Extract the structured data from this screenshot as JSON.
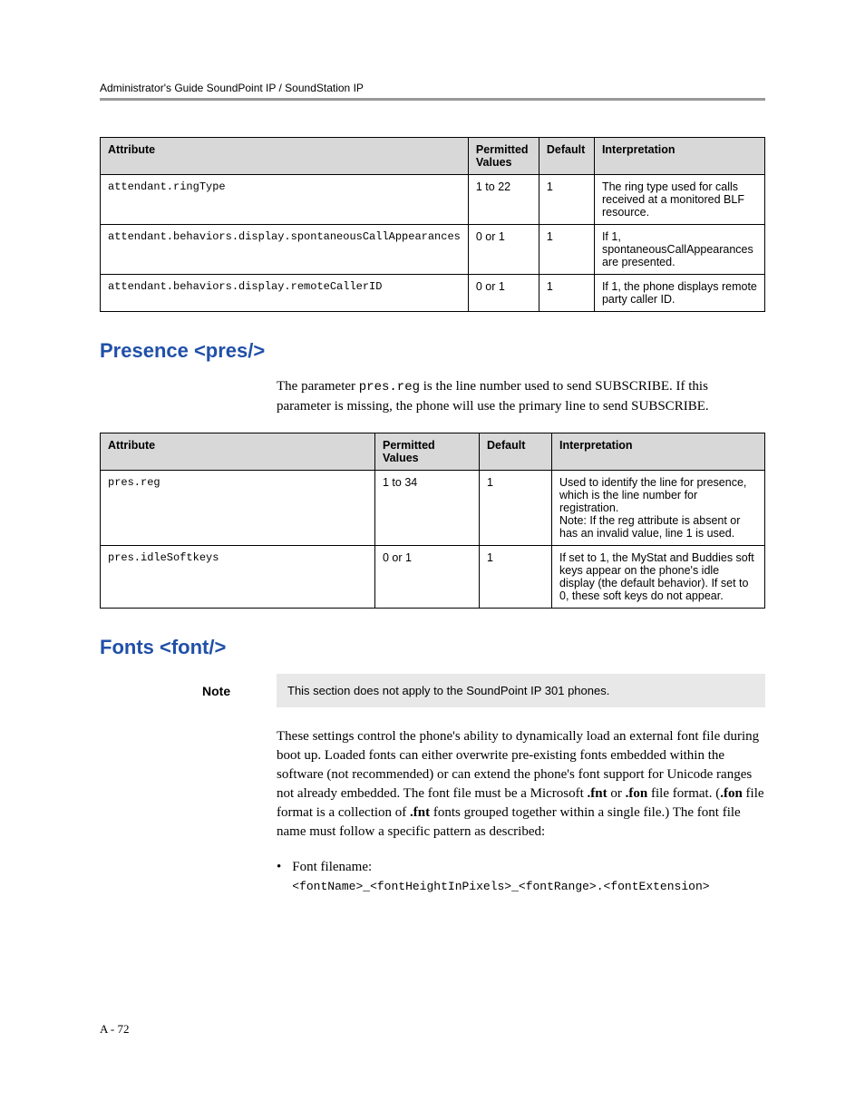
{
  "header": {
    "running_title": "Administrator's Guide SoundPoint IP / SoundStation IP"
  },
  "table1": {
    "head": {
      "c1": "Attribute",
      "c2": "Permitted Values",
      "c3": "Default",
      "c4": "Interpretation"
    },
    "row1": {
      "c1": "attendant.ringType",
      "c2": "1 to 22",
      "c3": "1",
      "c4": "The ring type used for calls received at a monitored BLF resource."
    },
    "row2": {
      "c1": "attendant.behaviors.display.spontaneousCallAppearances",
      "c2": "0 or 1",
      "c3": "1",
      "c4": "If 1, spontaneousCallAppearances are presented."
    },
    "row3": {
      "c1": "attendant.behaviors.display.remoteCallerID",
      "c2": "0 or 1",
      "c3": "1",
      "c4": "If 1, the phone displays remote party caller ID."
    }
  },
  "section_presence": {
    "heading": "Presence <pres/>",
    "para_pre": "The parameter ",
    "para_code": "pres.reg",
    "para_post": " is the line number used to send SUBSCRIBE. If this parameter is missing, the phone will use the primary line to send SUBSCRIBE."
  },
  "table2": {
    "head": {
      "c1": "Attribute",
      "c2": "Permitted Values",
      "c3": "Default",
      "c4": "Interpretation"
    },
    "row1": {
      "c1": "pres.reg",
      "c2": "1 to 34",
      "c3": "1",
      "c4": "Used to identify the line for presence, which is the line number for registration.\nNote: If the reg attribute is absent or has an invalid value, line 1 is used."
    },
    "row2": {
      "c1": "pres.idleSoftkeys",
      "c2": "0 or 1",
      "c3": "1",
      "c4": "If set to 1, the MyStat and Buddies soft keys appear on the phone's idle display (the default behavior). If set to 0, these soft keys do not appear."
    }
  },
  "section_fonts": {
    "heading": "Fonts <font/>",
    "note_label": "Note",
    "note_text": "This section does not apply to the SoundPoint IP 301 phones.",
    "para_main": "These settings control the phone's ability to dynamically load an external font file during boot up. Loaded fonts can either overwrite pre-existing fonts embedded within the software (not recommended) or can extend the phone's font support for Unicode ranges not already embedded. The font file must be a Microsoft ",
    "fnt": ".fnt",
    "or": " or ",
    "fon": ".fon",
    "para_main2": " file format. (",
    "para_main3": " file format is a collection of ",
    "para_main4": " fonts grouped together within a single file.) The font file name must follow a specific pattern as described:",
    "bullet_label": "Font filename: ",
    "bullet_mono": "<fontName>_<fontHeightInPixels>_<fontRange>.<fontExtension>"
  },
  "footer": {
    "page": "A - 72"
  }
}
